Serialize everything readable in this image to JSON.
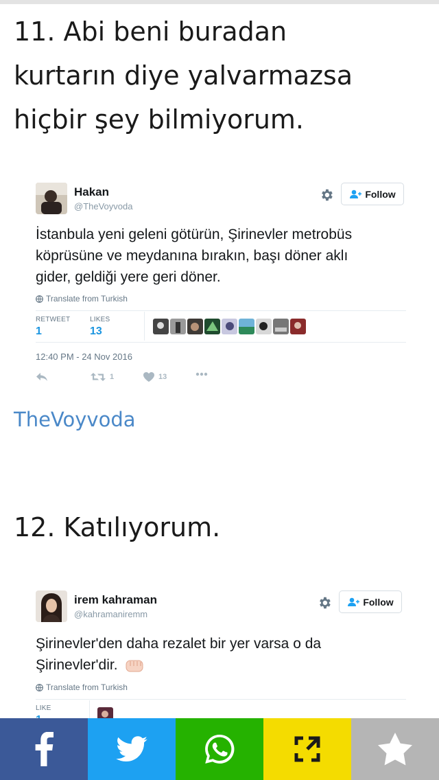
{
  "items": [
    {
      "heading_lines": [
        "11. Abi beni buradan",
        "kurtarın diye yalvarmazsa",
        "hiçbir şey bilmiyorum."
      ],
      "tweet": {
        "name": "Hakan",
        "handle": "@TheVoyvoda",
        "follow_label": "Follow",
        "text_lines": [
          "İstanbula yeni geleni götürün, Şirinevler metrobüs",
          "köprüsüne ve meydanına bırakın, başı döner aklı",
          "gider, geldiği yere geri döner."
        ],
        "translate_label": "Translate from Turkish",
        "retweets_label": "RETWEET",
        "retweets_count": "1",
        "likes_label": "LIKES",
        "likes_count": "13",
        "timestamp": "12:40 PM - 24 Nov 2016",
        "action_retweet_count": "1",
        "action_like_count": "13"
      },
      "source_link": "TheVoyvoda"
    },
    {
      "heading_lines": [
        "12. Katılıyorum."
      ],
      "tweet": {
        "name": "irem kahraman",
        "handle": "@kahramaniremm",
        "follow_label": "Follow",
        "text_lines": [
          "Şirinevler'den daha rezalet bir yer varsa o da",
          "Şirinevler'dir."
        ],
        "translate_label": "Translate from Turkish",
        "likes_label": "LIKE",
        "likes_count": "1"
      }
    }
  ],
  "share_bar": [
    {
      "name": "facebook-icon",
      "color": "#3b5998"
    },
    {
      "name": "twitter-icon",
      "color": "#1da1f2"
    },
    {
      "name": "whatsapp-icon",
      "color": "#25b200"
    },
    {
      "name": "share-expand-icon",
      "color": "#f4dc00"
    },
    {
      "name": "star-icon",
      "color": "#b5b5b5"
    }
  ]
}
